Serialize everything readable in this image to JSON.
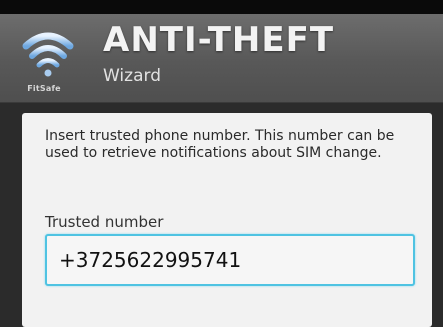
{
  "header": {
    "logo_text": "FitSafe",
    "title": "ANTI-THEFT",
    "subtitle": "Wizard"
  },
  "main": {
    "instruction": "Insert trusted phone number. This number can be used to retrieve notifications about SIM change.",
    "field_label": "Trusted number",
    "phone_value": "+3725622995741"
  },
  "colors": {
    "input_border": "#4fc3e2",
    "header_bg": "#5e5e5e",
    "panel_bg": "#f2f2f2"
  },
  "icons": {
    "logo": "wifi-shield-icon"
  }
}
